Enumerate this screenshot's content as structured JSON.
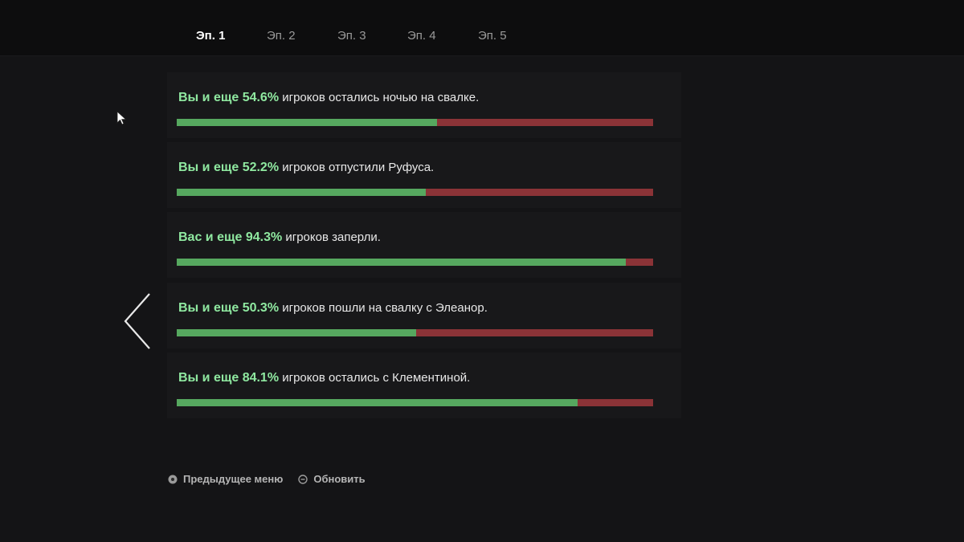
{
  "tabs": [
    {
      "label": "Эп. 1",
      "active": true
    },
    {
      "label": "Эп. 2",
      "active": false
    },
    {
      "label": "Эп. 3",
      "active": false
    },
    {
      "label": "Эп. 4",
      "active": false
    },
    {
      "label": "Эп. 5",
      "active": false
    }
  ],
  "choices": [
    {
      "lead": "Вы и еще 54.6%",
      "text": " игроков остались ночью на свалке.",
      "percent": 54.6
    },
    {
      "lead": "Вы и еще 52.2%",
      "text": " игроков отпустили Руфуса.",
      "percent": 52.2
    },
    {
      "lead": "Вас и еще 94.3%",
      "text": " игроков заперли.",
      "percent": 94.3
    },
    {
      "lead": "Вы и еще 50.3%",
      "text": " игроков пошли на свалку с Элеанор.",
      "percent": 50.3
    },
    {
      "lead": "Вы и еще 84.1%",
      "text": " игроков остались с Клементиной.",
      "percent": 84.1
    }
  ],
  "footer": {
    "prev_menu_label": "Предыдущее меню",
    "refresh_label": "Обновить"
  },
  "icons": {
    "prev": "circle-button-icon",
    "refresh": "circle-minus-button-icon",
    "back": "chevron-left-icon",
    "cursor": "mouse-cursor-icon"
  },
  "colors": {
    "highlight": "#8fe8a0",
    "bar_majority": "#56a85f",
    "bar_rest": "#8b3337",
    "background": "#141416"
  }
}
